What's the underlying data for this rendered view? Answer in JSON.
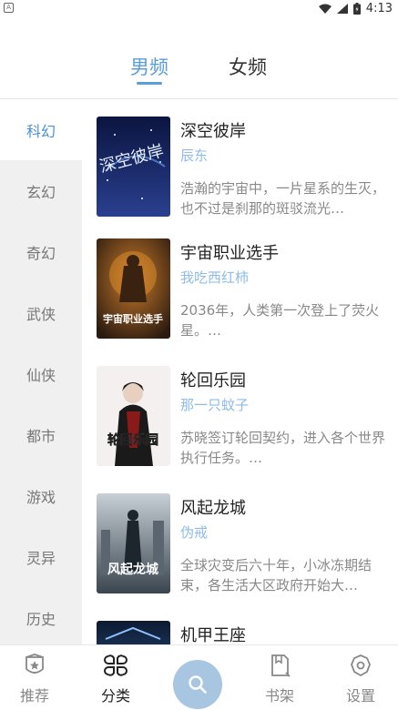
{
  "status_bar": {
    "left_icon": "A",
    "time": "4:13"
  },
  "tabs": [
    {
      "label": "男频",
      "active": true
    },
    {
      "label": "女频",
      "active": false
    }
  ],
  "sidebar": {
    "items": [
      {
        "label": "科幻",
        "active": true
      },
      {
        "label": "玄幻"
      },
      {
        "label": "奇幻"
      },
      {
        "label": "武侠"
      },
      {
        "label": "仙侠"
      },
      {
        "label": "都市"
      },
      {
        "label": "游戏"
      },
      {
        "label": "灵异"
      },
      {
        "label": "历史"
      }
    ]
  },
  "books": [
    {
      "title": "深空彼岸",
      "author": "辰东",
      "desc": "浩瀚的宇宙中，一片星系的生灭，也不过是刹那的斑驳流光…",
      "cover_text": "深空彼岸",
      "cover_colors": [
        "#0b1540",
        "#2a3f8f"
      ]
    },
    {
      "title": "宇宙职业选手",
      "author": "我吃西红柿",
      "desc": "2036年，人类第一次登上了荧火星。…",
      "cover_text": "宇宙职业选手",
      "cover_colors": [
        "#2a1a10",
        "#8a4a1a"
      ]
    },
    {
      "title": "轮回乐园",
      "author": "那一只蚊子",
      "desc": "苏晓签订轮回契约，进入各个世界执行任务。…",
      "cover_text": "轮回乐园",
      "cover_colors": [
        "#f4f0f0",
        "#8a1a1a"
      ]
    },
    {
      "title": "风起龙城",
      "author": "伪戒",
      "desc": "全球灾变后六十年，小冰冻期结束，各生活大区政府开始大…",
      "cover_text": "风起龙城",
      "cover_colors": [
        "#c8d0d6",
        "#3a454f"
      ]
    },
    {
      "title": "机甲王座",
      "author": "",
      "desc": "",
      "cover_text": "",
      "cover_colors": [
        "#0d1a30",
        "#3a6ab0"
      ]
    }
  ],
  "bottom_nav": {
    "items": [
      {
        "label": "推荐",
        "icon": "shield-star-icon"
      },
      {
        "label": "分类",
        "icon": "category-icon",
        "active": true
      },
      {
        "label": "",
        "icon": "search-icon"
      },
      {
        "label": "书架",
        "icon": "bookshelf-icon"
      },
      {
        "label": "设置",
        "icon": "settings-icon"
      }
    ]
  },
  "colors": {
    "accent": "#5a9ed9",
    "author": "#8fbbe8",
    "sidebar_bg": "#f0f0f0",
    "search_button": "#a8c6e2"
  }
}
